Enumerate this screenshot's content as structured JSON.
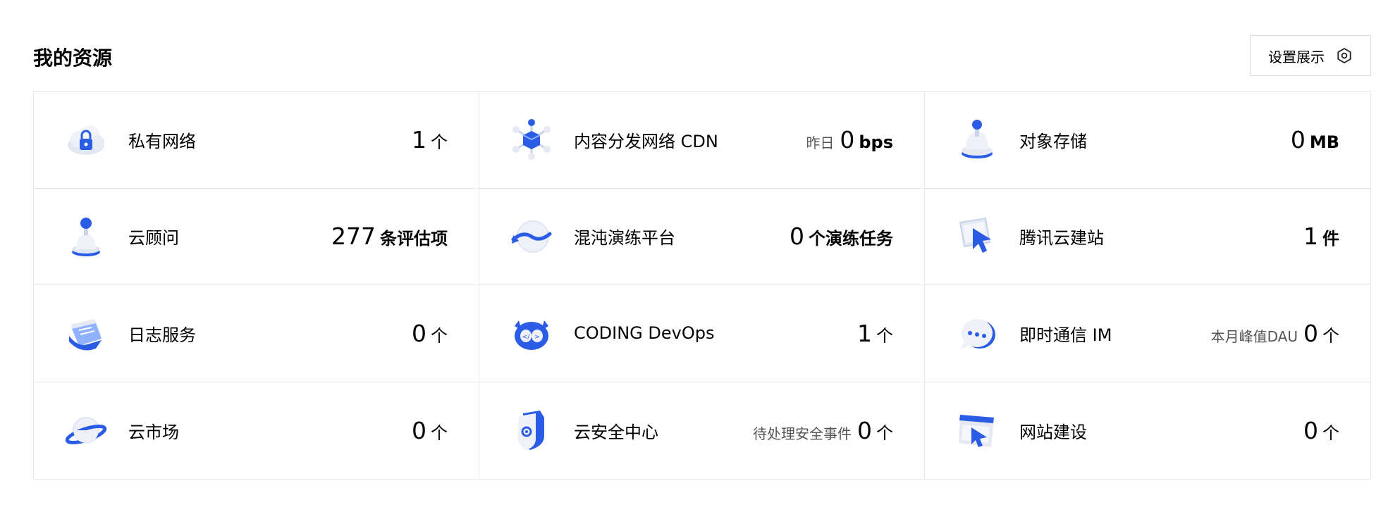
{
  "header": {
    "title": "我的资源",
    "settings_label": "设置展示"
  },
  "resources": [
    {
      "name": "私有网络",
      "prefix": "",
      "value": "1",
      "unit": "个",
      "icon": "vpc-cloud-lock-icon"
    },
    {
      "name": "内容分发网络 CDN",
      "prefix": "昨日",
      "value": "0",
      "unit": "bps",
      "icon": "cdn-network-icon"
    },
    {
      "name": "对象存储",
      "prefix": "",
      "value": "0",
      "unit": "MB",
      "icon": "object-storage-icon"
    },
    {
      "name": "云顾问",
      "prefix": "",
      "value": "277",
      "unit": "条评估项",
      "icon": "cloud-advisor-icon"
    },
    {
      "name": "混沌演练平台",
      "prefix": "",
      "value": "0",
      "unit": "个演练任务",
      "icon": "chaos-platform-icon"
    },
    {
      "name": "腾讯云建站",
      "prefix": "",
      "value": "1",
      "unit": "件",
      "icon": "site-builder-cursor-icon"
    },
    {
      "name": "日志服务",
      "prefix": "",
      "value": "0",
      "unit": "个",
      "icon": "log-service-icon"
    },
    {
      "name": "CODING DevOps",
      "prefix": "",
      "value": "1",
      "unit": "个",
      "icon": "coding-devops-icon"
    },
    {
      "name": "即时通信 IM",
      "prefix": "本月峰值DAU",
      "value": "0",
      "unit": "个",
      "icon": "chat-bubble-icon"
    },
    {
      "name": "云市场",
      "prefix": "",
      "value": "0",
      "unit": "个",
      "icon": "cloud-market-planet-icon"
    },
    {
      "name": "云安全中心",
      "prefix": "待处理安全事件",
      "value": "0",
      "unit": "个",
      "icon": "security-shield-icon"
    },
    {
      "name": "网站建设",
      "prefix": "",
      "value": "0",
      "unit": "个",
      "icon": "website-build-icon"
    }
  ],
  "colors": {
    "accent": "#2b5ce6",
    "accent_light": "#8fb1ff",
    "icon_base": "#e6e9f2",
    "border": "#e8e8e8"
  }
}
